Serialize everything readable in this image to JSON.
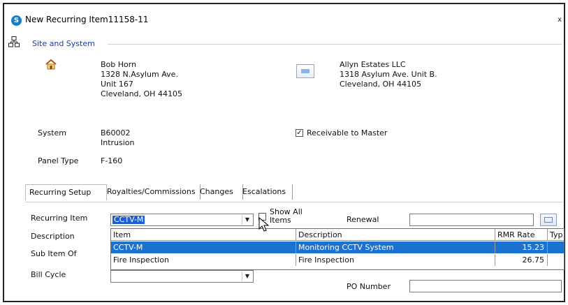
{
  "window": {
    "title": "New Recurring Item11158-11",
    "app_icon_letter": "S",
    "close_glyph": "x"
  },
  "site_section": {
    "title": "Site and System"
  },
  "site_address": {
    "name": "Bob Horn",
    "line1": "1328 N.Asylum Ave.",
    "line2": "Unit 167",
    "city_state_zip": "Cleveland, OH  44105"
  },
  "billing_address": {
    "name": "Allyn Estates LLC",
    "line1": "1318 Asylum Ave. Unit B.",
    "city_state_zip": "Cleveland, OH  44105"
  },
  "system": {
    "label": "System",
    "number": "B60002",
    "type": "Intrusion",
    "panel_label": "Panel Type",
    "panel_value": "F-160"
  },
  "receivable": {
    "label": "Receivable to Master",
    "checked": true,
    "check_glyph": "✓"
  },
  "tabs": [
    {
      "label": "Recurring Setup",
      "active": true
    },
    {
      "label": "Royalties/Commissions",
      "active": false
    },
    {
      "label": "Changes",
      "active": false
    },
    {
      "label": "Escalations",
      "active": false
    }
  ],
  "form": {
    "recurring_item_label": "Recurring Item",
    "recurring_item_value": "CCTV-M",
    "show_all_label": "Show All Items",
    "renewal_label": "Renewal",
    "renewal_value": "",
    "description_label": "Description",
    "sub_item_label": "Sub Item Of",
    "bill_cycle_label": "Bill Cycle",
    "bill_cycle_value": "",
    "po_number_label": "PO Number",
    "po_number_value": ""
  },
  "dropdown": {
    "columns": [
      "Item",
      "Description",
      "RMR Rate",
      "Typ"
    ],
    "rows": [
      {
        "item": "CCTV-M",
        "description": "Monitoring CCTV System",
        "rate": "15.23",
        "selected": true
      },
      {
        "item": "Fire Inspection",
        "description": "Fire Inspection",
        "rate": "26.75",
        "selected": false
      }
    ]
  },
  "colors": {
    "accent": "#1a3ea0",
    "selection": "#1b72d1",
    "app_icon": "#1a7fc1"
  }
}
